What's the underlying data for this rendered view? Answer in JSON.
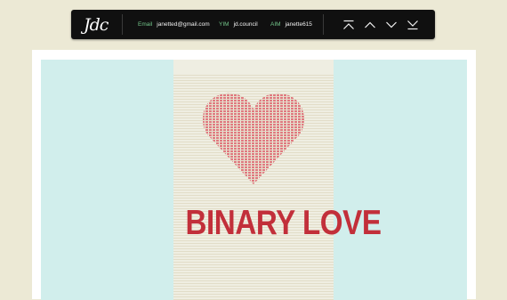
{
  "header": {
    "logo_text": "Jdc",
    "contacts": [
      {
        "label": "Email",
        "value": "janetted@gmail.com"
      },
      {
        "label": "YIM",
        "value": "jd.council"
      },
      {
        "label": "AIM",
        "value": "janette615"
      }
    ],
    "nav_buttons": [
      "first-icon",
      "previous-icon",
      "next-icon",
      "last-icon"
    ]
  },
  "poster": {
    "title": "BINARY LOVE",
    "heart_color": "#e07a80",
    "title_color": "#c22f3a",
    "background_color": "#d1eeec"
  }
}
